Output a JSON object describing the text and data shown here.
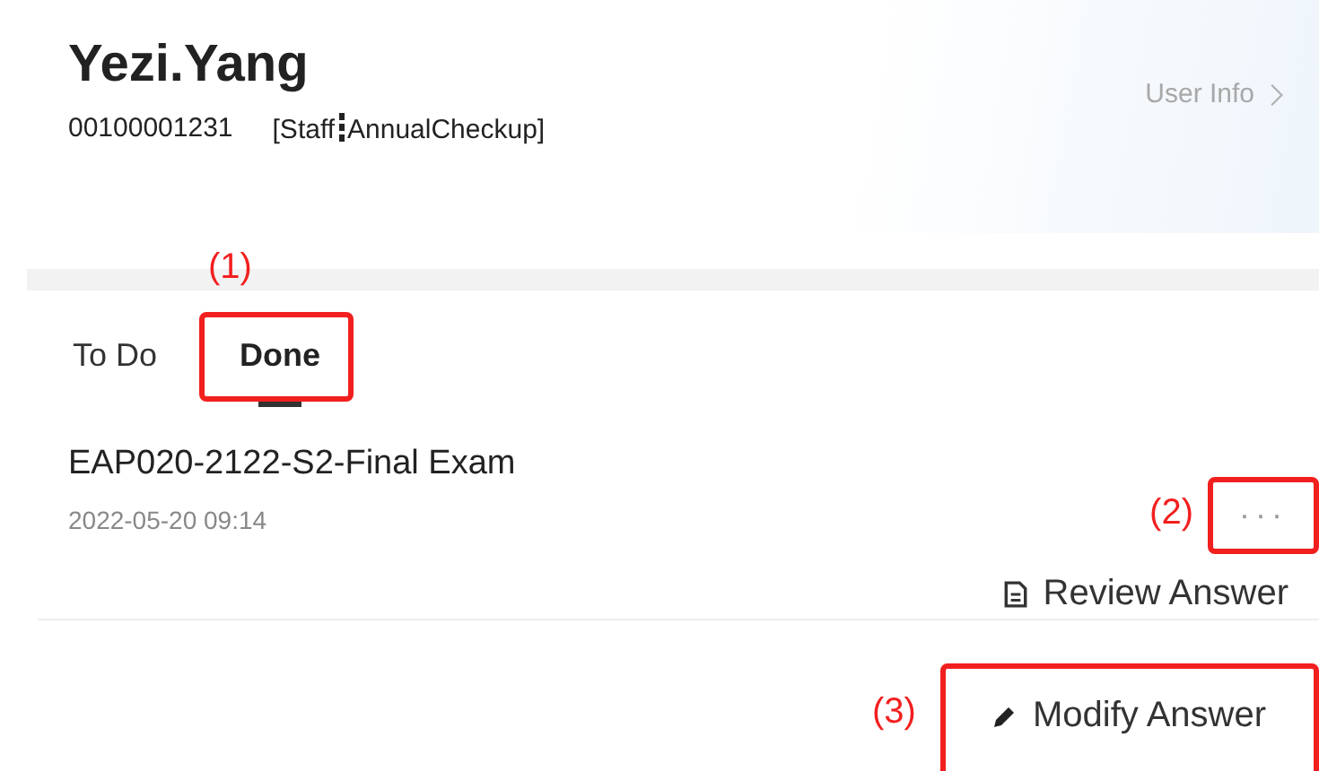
{
  "user": {
    "name": "Yezi.Yang",
    "id": "00100001231",
    "role": "[Staff",
    "program": "AnnualCheckup]",
    "info_link": "User Info"
  },
  "tabs": [
    {
      "label": "To Do",
      "selected": false
    },
    {
      "label": "Done",
      "selected": true,
      "annotation": "(1)"
    }
  ],
  "items": [
    {
      "title": "EAP020-2122-S2-Final Exam",
      "date": "2022-05-20 09:14",
      "more": "···",
      "more_annotation": "(2)",
      "actions": [
        {
          "kind": "review",
          "label": "Review Answer"
        },
        {
          "kind": "modify",
          "label": "Modify Answer",
          "annotation": "(3)"
        }
      ]
    }
  ]
}
